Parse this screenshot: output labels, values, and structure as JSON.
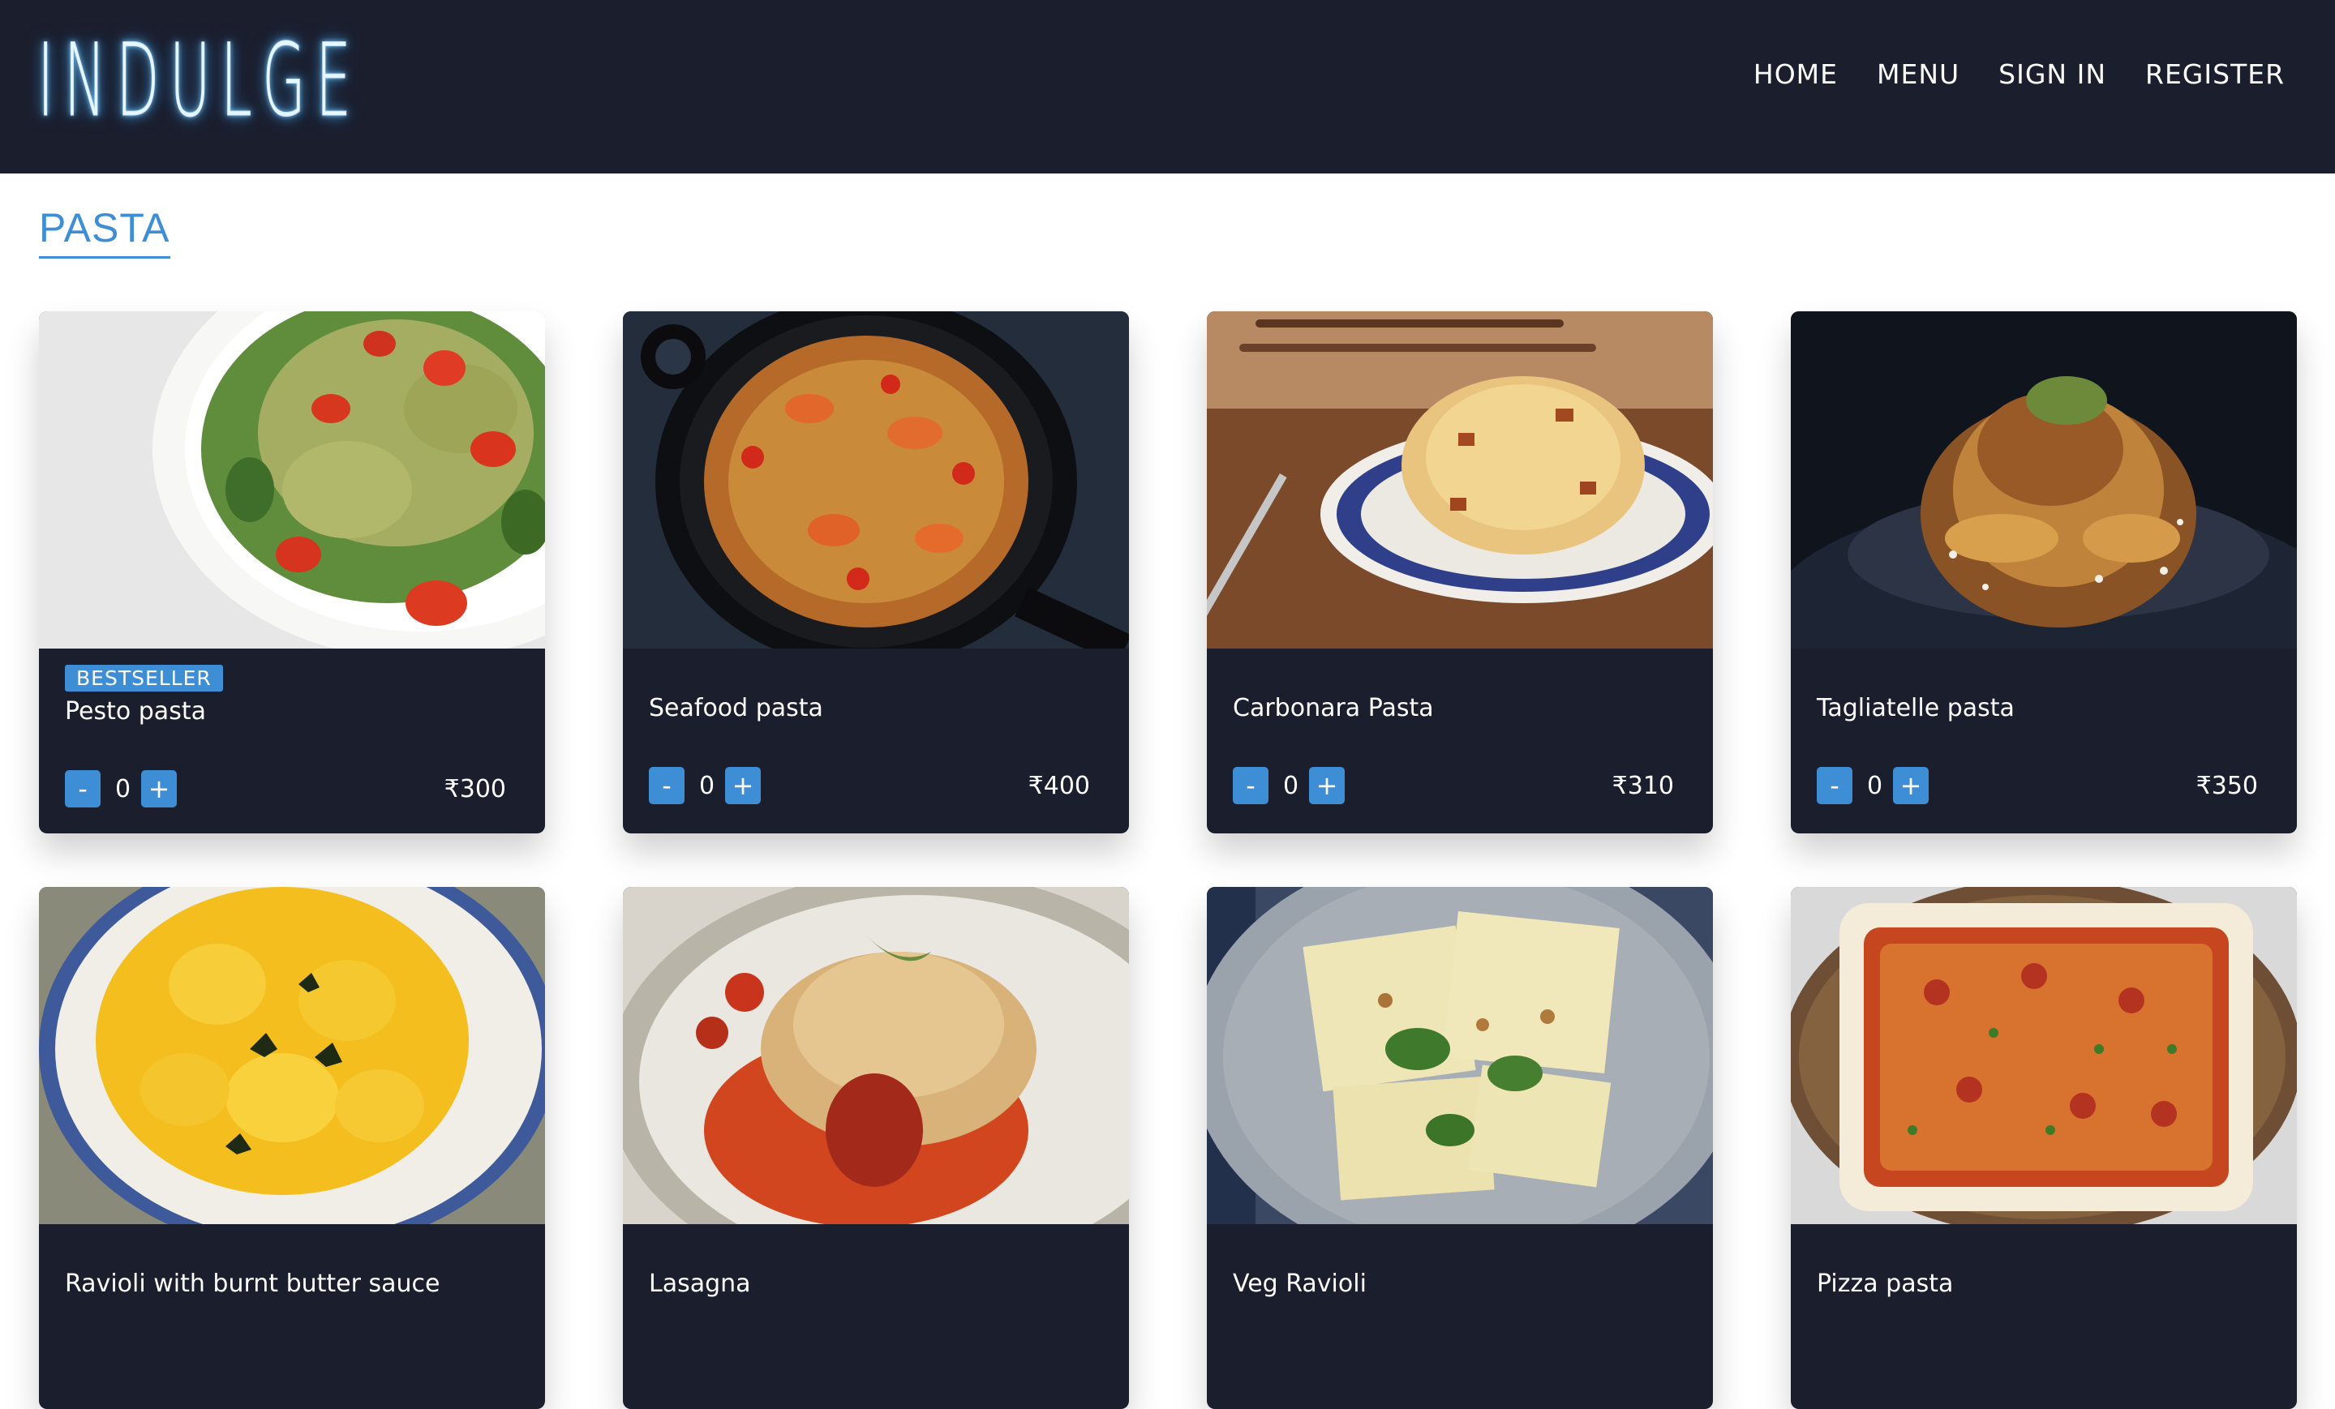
{
  "header": {
    "logo": "INDULGE",
    "nav": [
      "HOME",
      "MENU",
      "SIGN IN",
      "REGISTER"
    ]
  },
  "section": {
    "title": "PASTA"
  },
  "items": [
    {
      "name": "Pesto pasta",
      "badge": "BESTSELLER",
      "qty": "0",
      "price": "₹300",
      "minus": "-",
      "plus": "+"
    },
    {
      "name": "Seafood pasta",
      "qty": "0",
      "price": "₹400",
      "minus": "-",
      "plus": "+"
    },
    {
      "name": "Carbonara Pasta",
      "qty": "0",
      "price": "₹310",
      "minus": "-",
      "plus": "+"
    },
    {
      "name": "Tagliatelle pasta",
      "qty": "0",
      "price": "₹350",
      "minus": "-",
      "plus": "+"
    },
    {
      "name": "Ravioli with burnt butter sauce"
    },
    {
      "name": "Lasagna"
    },
    {
      "name": "Veg Ravioli"
    },
    {
      "name": "Pizza pasta"
    }
  ],
  "colors": {
    "navbar": "#1b1e2d",
    "accent": "#3d8ed5"
  }
}
